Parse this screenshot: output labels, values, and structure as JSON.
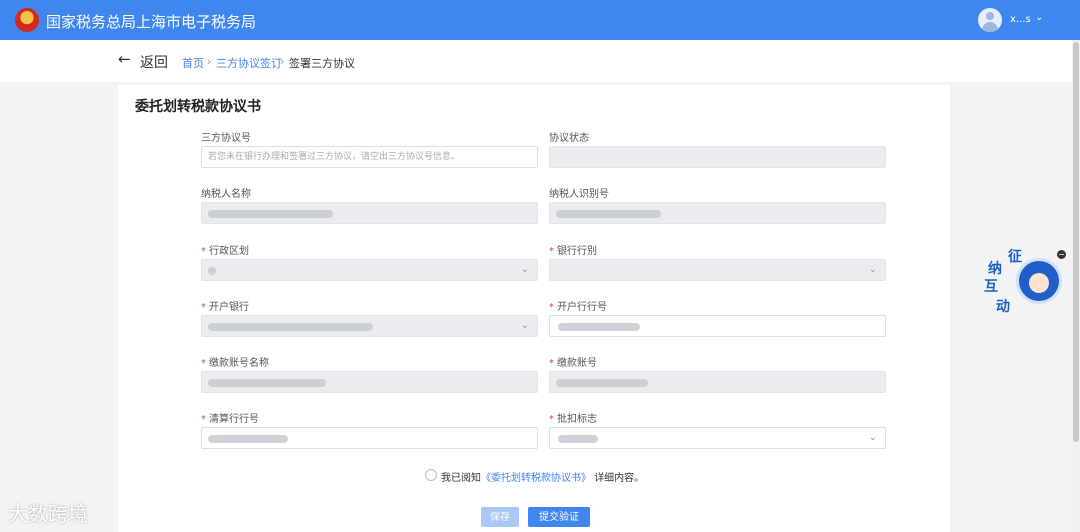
{
  "header": {
    "title": "国家税务总局上海市电子税务局",
    "user_name": "x...s",
    "emblem_icon": "tax-emblem",
    "brand_color": "#3f86ee"
  },
  "nav": {
    "back_label": "返回",
    "breadcrumb": [
      "首页",
      "三方协议签订",
      "签署三方协议"
    ]
  },
  "form": {
    "title": "委托划转税款协议书",
    "fields": {
      "agreement_no": {
        "label": "三方协议号",
        "placeholder": "若您未在银行办理和签署过三方协议，请空出三方协议号信息。"
      },
      "agreement_status": {
        "label": "协议状态"
      },
      "taxpayer_name": {
        "label": "纳税人名称"
      },
      "taxpayer_id": {
        "label": "纳税人识别号"
      },
      "admin_region": {
        "label": "行政区划"
      },
      "bank_type": {
        "label": "银行行别"
      },
      "open_bank": {
        "label": "开户银行"
      },
      "open_bank_no": {
        "label": "开户行行号"
      },
      "account_name": {
        "label": "缴款账号名称"
      },
      "account_no": {
        "label": "缴款账号"
      },
      "clearing_bank_no": {
        "label": "清算行行号"
      },
      "batch_flag": {
        "label": "批扣标志"
      }
    },
    "agreement": {
      "prefix": "我已阅知",
      "link": "《委托划转税款协议书》",
      "suffix": "详细内容。"
    },
    "buttons": {
      "save": "保存",
      "submit": "提交验证"
    }
  },
  "widget": {
    "chars": [
      "征",
      "纳",
      "互",
      "动"
    ]
  },
  "watermark": "大数跨境"
}
